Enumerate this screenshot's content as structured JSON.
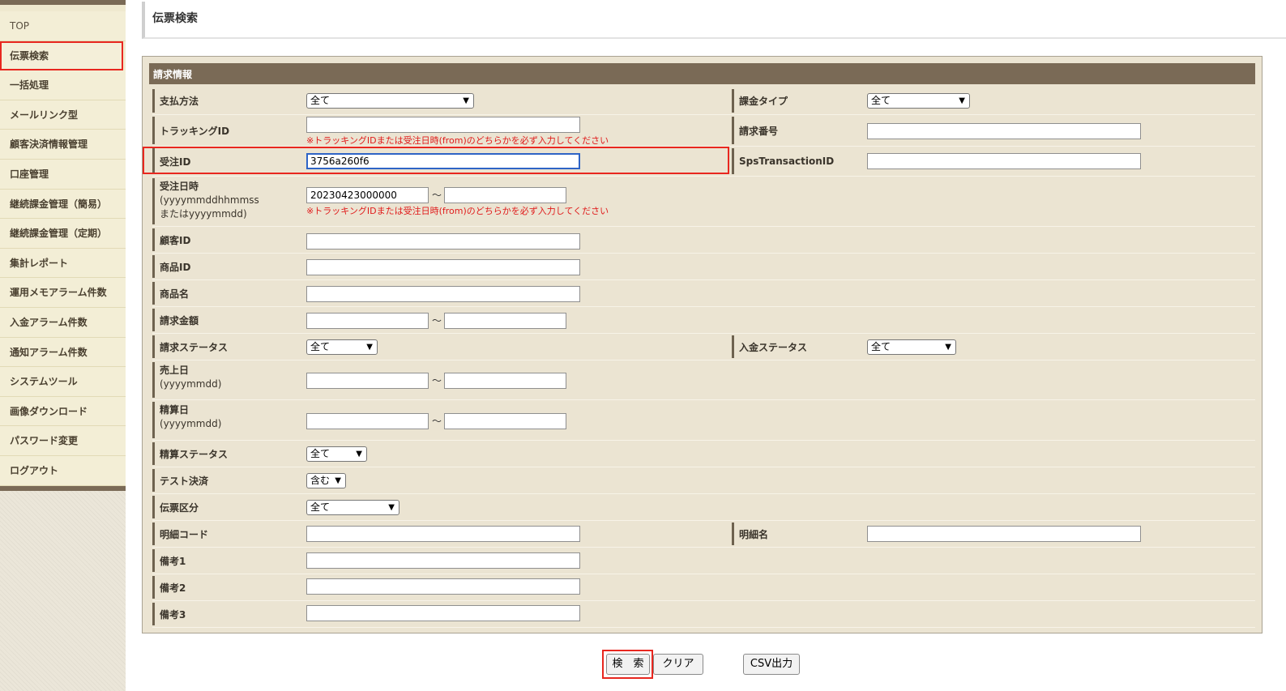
{
  "sidebar": {
    "items": [
      {
        "label": "TOP"
      },
      {
        "label": "伝票検索"
      },
      {
        "label": "一括処理"
      },
      {
        "label": "メールリンク型"
      },
      {
        "label": "顧客決済情報管理"
      },
      {
        "label": "口座管理"
      },
      {
        "label": "継続課金管理（簡易）"
      },
      {
        "label": "継続課金管理（定期）"
      },
      {
        "label": "集計レポート"
      },
      {
        "label": "運用メモアラーム件数"
      },
      {
        "label": "入金アラーム件数"
      },
      {
        "label": "通知アラーム件数"
      },
      {
        "label": "システムツール"
      },
      {
        "label": "画像ダウンロード"
      },
      {
        "label": "パスワード変更"
      },
      {
        "label": "ログアウト"
      }
    ],
    "active_index": 1
  },
  "header": {
    "title": "伝票検索"
  },
  "panel": {
    "title": "請求情報",
    "warning_text": "※トラッキングIDまたは受注日時(from)のどちらかを必ず入力してください",
    "tilde": "〜",
    "fields": {
      "payment_method": {
        "label": "支払方法",
        "value": "全て"
      },
      "billing_type": {
        "label": "課金タイプ",
        "value": "全て"
      },
      "tracking_id": {
        "label": "トラッキングID",
        "value": ""
      },
      "invoice_number": {
        "label": "請求番号",
        "value": ""
      },
      "order_id": {
        "label": "受注ID",
        "value": "3756a260f6"
      },
      "sps_transaction_id": {
        "label": "SpsTransactionID",
        "value": ""
      },
      "order_datetime": {
        "label": "受注日時",
        "label_sub1": "(yyyymmddhhmmss",
        "label_sub2": "またはyyyymmdd)",
        "from": "20230423000000",
        "to": ""
      },
      "customer_id": {
        "label": "顧客ID",
        "value": ""
      },
      "product_id": {
        "label": "商品ID",
        "value": ""
      },
      "product_name": {
        "label": "商品名",
        "value": ""
      },
      "billing_amount": {
        "label": "請求金額",
        "from": "",
        "to": ""
      },
      "billing_status": {
        "label": "請求ステータス",
        "value": "全て"
      },
      "payment_status": {
        "label": "入金ステータス",
        "value": "全て"
      },
      "sales_date": {
        "label": "売上日",
        "label_sub1": "(yyyymmdd)",
        "from": "",
        "to": ""
      },
      "settlement_date": {
        "label": "精算日",
        "label_sub1": "(yyyymmdd)",
        "from": "",
        "to": ""
      },
      "settlement_status": {
        "label": "精算ステータス",
        "value": "全て"
      },
      "test_payment": {
        "label": "テスト決済",
        "value": "含む"
      },
      "slip_type": {
        "label": "伝票区分",
        "value": "全て"
      },
      "detail_code": {
        "label": "明細コード",
        "value": ""
      },
      "detail_name": {
        "label": "明細名",
        "value": ""
      },
      "remarks1": {
        "label": "備考1",
        "value": ""
      },
      "remarks2": {
        "label": "備考2",
        "value": ""
      },
      "remarks3": {
        "label": "備考3",
        "value": ""
      }
    }
  },
  "buttons": {
    "search": "検　索",
    "clear": "クリア",
    "csv": "CSV出力"
  },
  "colors": {
    "panel_header": "#7a6a56",
    "panel_bg": "#ebe4d2",
    "highlight": "#e8271f",
    "warning": "#e01b1b",
    "focus": "#2e64c6"
  }
}
